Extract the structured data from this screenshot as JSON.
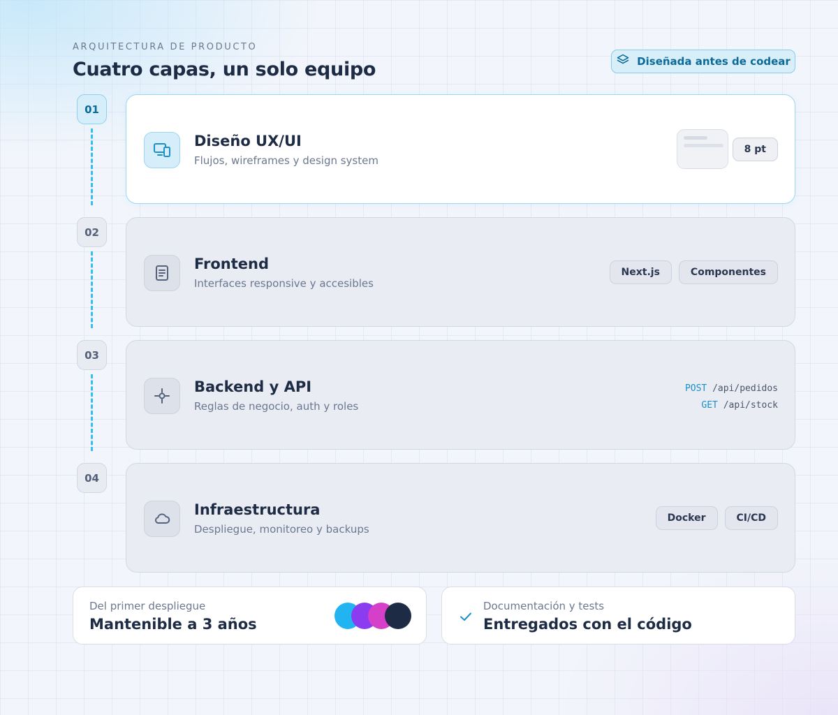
{
  "header": {
    "eyebrow": "ARQUITECTURA DE PRODUCTO",
    "title": "Cuatro capas, un solo equipo",
    "badge_label": "Diseñada antes de codear",
    "badge_icon": "layers-icon"
  },
  "layers": [
    {
      "step": "01",
      "title": "Diseño UX/UI",
      "subtitle": "Flujos, wireframes y design system",
      "icon": "devices-icon",
      "chip": "8 pt",
      "active": true
    },
    {
      "step": "02",
      "title": "Frontend",
      "subtitle": "Interfaces responsive y accesibles",
      "icon": "document-icon",
      "chips": [
        "Next.js",
        "Componentes"
      ]
    },
    {
      "step": "03",
      "title": "Backend y API",
      "subtitle": "Reglas de negocio, auth y roles",
      "icon": "crosshair-icon",
      "endpoints": [
        {
          "method": "POST",
          "path": "/api/pedidos"
        },
        {
          "method": "GET",
          "path": "/api/stock"
        }
      ]
    },
    {
      "step": "04",
      "title": "Infraestructura",
      "subtitle": "Despliegue, monitoreo y backups",
      "icon": "cloud-icon",
      "chips": [
        "Docker",
        "CI/CD"
      ]
    }
  ],
  "stats": [
    {
      "label": "Del primer despliegue",
      "value": "Mantenible a 3 años",
      "swatches": [
        "#22b4f0",
        "#8b3cf0",
        "#d63fc8",
        "#1e2b45"
      ]
    },
    {
      "label": "Documentación y tests",
      "value": "Entregados con el código",
      "icon": "check-icon"
    }
  ],
  "colors": {
    "accent": "#38bdf0",
    "accent_dark": "#0b6a99",
    "text": "#1e2b45",
    "muted": "#6b7890"
  }
}
